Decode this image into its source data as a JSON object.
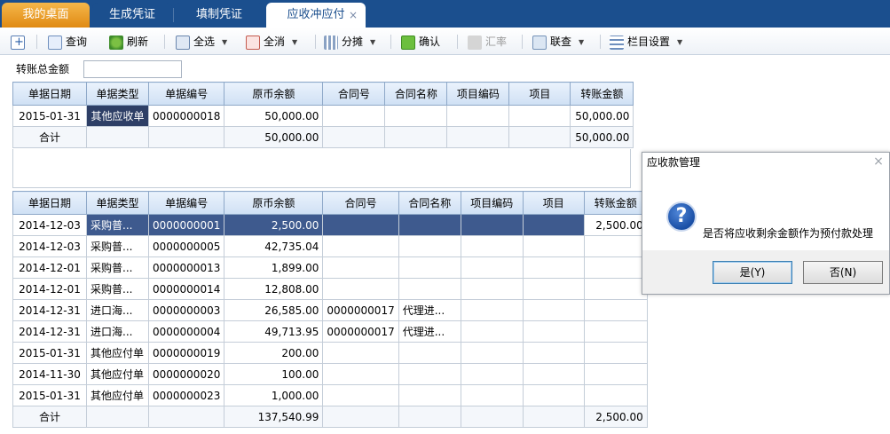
{
  "tabs": {
    "home": "我的桌面",
    "tab1": "生成凭证",
    "tab2": "填制凭证",
    "active": "应收冲应付",
    "close": "×"
  },
  "toolbar": {
    "query": "查询",
    "refresh": "刷新",
    "select_all": "全选",
    "deselect_all": "全消",
    "split": "分摊",
    "confirm": "确认",
    "exchange_rate": "汇率",
    "linked_query": "联查",
    "column_settings": "栏目设置"
  },
  "total_amount": {
    "label": "转账总金额",
    "value": ""
  },
  "grid1": {
    "headers": [
      "单据日期",
      "单据类型",
      "单据编号",
      "原币余额",
      "合同号",
      "合同名称",
      "项目编码",
      "项目",
      "转账金额"
    ],
    "rows": [
      [
        "2015-01-31",
        "其他应收单",
        "0000000018",
        "50,000.00",
        "",
        "",
        "",
        "",
        "50,000.00"
      ],
      [
        "合计",
        "",
        "",
        "50,000.00",
        "",
        "",
        "",
        "",
        "50,000.00"
      ]
    ]
  },
  "grid2": {
    "headers": [
      "单据日期",
      "单据类型",
      "单据编号",
      "原币余额",
      "合同号",
      "合同名称",
      "项目编码",
      "项目",
      "转账金额"
    ],
    "rows": [
      [
        "2014-12-03",
        "采购普...",
        "0000000001",
        "2,500.00",
        "",
        "",
        "",
        "",
        "2,500.00"
      ],
      [
        "2014-12-03",
        "采购普...",
        "0000000005",
        "42,735.04",
        "",
        "",
        "",
        "",
        ""
      ],
      [
        "2014-12-01",
        "采购普...",
        "0000000013",
        "1,899.00",
        "",
        "",
        "",
        "",
        ""
      ],
      [
        "2014-12-01",
        "采购普...",
        "0000000014",
        "12,808.00",
        "",
        "",
        "",
        "",
        ""
      ],
      [
        "2014-12-31",
        "进口海...",
        "0000000003",
        "26,585.00",
        "0000000017",
        "代理进...",
        "",
        "",
        ""
      ],
      [
        "2014-12-31",
        "进口海...",
        "0000000004",
        "49,713.95",
        "0000000017",
        "代理进...",
        "",
        "",
        ""
      ],
      [
        "2015-01-31",
        "其他应付单",
        "0000000019",
        "200.00",
        "",
        "",
        "",
        "",
        ""
      ],
      [
        "2014-11-30",
        "其他应付单",
        "0000000020",
        "100.00",
        "",
        "",
        "",
        "",
        ""
      ],
      [
        "2015-01-31",
        "其他应付单",
        "0000000023",
        "1,000.00",
        "",
        "",
        "",
        "",
        ""
      ],
      [
        "合计",
        "",
        "",
        "137,540.99",
        "",
        "",
        "",
        "",
        "2,500.00"
      ]
    ]
  },
  "dialog": {
    "title": "应收款管理",
    "close": "×",
    "icon": "?",
    "message": "是否将应收剩余金额作为预付款处理",
    "yes_label": "是(Y)",
    "no_label": "否(N)"
  }
}
